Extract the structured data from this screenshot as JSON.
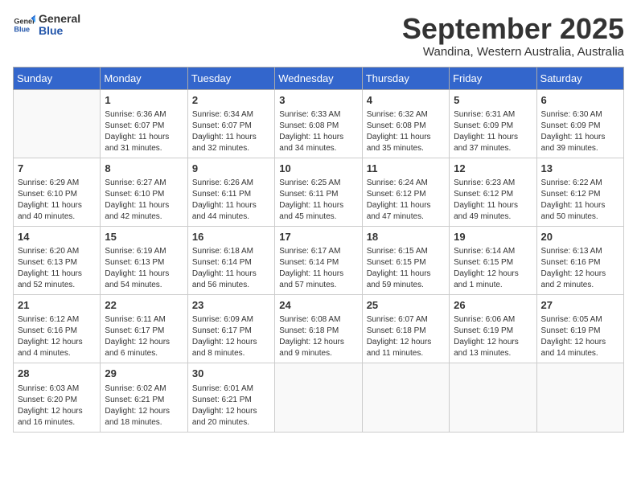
{
  "header": {
    "logo_general": "General",
    "logo_blue": "Blue",
    "month_title": "September 2025",
    "subtitle": "Wandina, Western Australia, Australia"
  },
  "weekdays": [
    "Sunday",
    "Monday",
    "Tuesday",
    "Wednesday",
    "Thursday",
    "Friday",
    "Saturday"
  ],
  "weeks": [
    [
      {
        "day": "",
        "info": ""
      },
      {
        "day": "1",
        "info": "Sunrise: 6:36 AM\nSunset: 6:07 PM\nDaylight: 11 hours\nand 31 minutes."
      },
      {
        "day": "2",
        "info": "Sunrise: 6:34 AM\nSunset: 6:07 PM\nDaylight: 11 hours\nand 32 minutes."
      },
      {
        "day": "3",
        "info": "Sunrise: 6:33 AM\nSunset: 6:08 PM\nDaylight: 11 hours\nand 34 minutes."
      },
      {
        "day": "4",
        "info": "Sunrise: 6:32 AM\nSunset: 6:08 PM\nDaylight: 11 hours\nand 35 minutes."
      },
      {
        "day": "5",
        "info": "Sunrise: 6:31 AM\nSunset: 6:09 PM\nDaylight: 11 hours\nand 37 minutes."
      },
      {
        "day": "6",
        "info": "Sunrise: 6:30 AM\nSunset: 6:09 PM\nDaylight: 11 hours\nand 39 minutes."
      }
    ],
    [
      {
        "day": "7",
        "info": "Sunrise: 6:29 AM\nSunset: 6:10 PM\nDaylight: 11 hours\nand 40 minutes."
      },
      {
        "day": "8",
        "info": "Sunrise: 6:27 AM\nSunset: 6:10 PM\nDaylight: 11 hours\nand 42 minutes."
      },
      {
        "day": "9",
        "info": "Sunrise: 6:26 AM\nSunset: 6:11 PM\nDaylight: 11 hours\nand 44 minutes."
      },
      {
        "day": "10",
        "info": "Sunrise: 6:25 AM\nSunset: 6:11 PM\nDaylight: 11 hours\nand 45 minutes."
      },
      {
        "day": "11",
        "info": "Sunrise: 6:24 AM\nSunset: 6:12 PM\nDaylight: 11 hours\nand 47 minutes."
      },
      {
        "day": "12",
        "info": "Sunrise: 6:23 AM\nSunset: 6:12 PM\nDaylight: 11 hours\nand 49 minutes."
      },
      {
        "day": "13",
        "info": "Sunrise: 6:22 AM\nSunset: 6:12 PM\nDaylight: 11 hours\nand 50 minutes."
      }
    ],
    [
      {
        "day": "14",
        "info": "Sunrise: 6:20 AM\nSunset: 6:13 PM\nDaylight: 11 hours\nand 52 minutes."
      },
      {
        "day": "15",
        "info": "Sunrise: 6:19 AM\nSunset: 6:13 PM\nDaylight: 11 hours\nand 54 minutes."
      },
      {
        "day": "16",
        "info": "Sunrise: 6:18 AM\nSunset: 6:14 PM\nDaylight: 11 hours\nand 56 minutes."
      },
      {
        "day": "17",
        "info": "Sunrise: 6:17 AM\nSunset: 6:14 PM\nDaylight: 11 hours\nand 57 minutes."
      },
      {
        "day": "18",
        "info": "Sunrise: 6:15 AM\nSunset: 6:15 PM\nDaylight: 11 hours\nand 59 minutes."
      },
      {
        "day": "19",
        "info": "Sunrise: 6:14 AM\nSunset: 6:15 PM\nDaylight: 12 hours\nand 1 minute."
      },
      {
        "day": "20",
        "info": "Sunrise: 6:13 AM\nSunset: 6:16 PM\nDaylight: 12 hours\nand 2 minutes."
      }
    ],
    [
      {
        "day": "21",
        "info": "Sunrise: 6:12 AM\nSunset: 6:16 PM\nDaylight: 12 hours\nand 4 minutes."
      },
      {
        "day": "22",
        "info": "Sunrise: 6:11 AM\nSunset: 6:17 PM\nDaylight: 12 hours\nand 6 minutes."
      },
      {
        "day": "23",
        "info": "Sunrise: 6:09 AM\nSunset: 6:17 PM\nDaylight: 12 hours\nand 8 minutes."
      },
      {
        "day": "24",
        "info": "Sunrise: 6:08 AM\nSunset: 6:18 PM\nDaylight: 12 hours\nand 9 minutes."
      },
      {
        "day": "25",
        "info": "Sunrise: 6:07 AM\nSunset: 6:18 PM\nDaylight: 12 hours\nand 11 minutes."
      },
      {
        "day": "26",
        "info": "Sunrise: 6:06 AM\nSunset: 6:19 PM\nDaylight: 12 hours\nand 13 minutes."
      },
      {
        "day": "27",
        "info": "Sunrise: 6:05 AM\nSunset: 6:19 PM\nDaylight: 12 hours\nand 14 minutes."
      }
    ],
    [
      {
        "day": "28",
        "info": "Sunrise: 6:03 AM\nSunset: 6:20 PM\nDaylight: 12 hours\nand 16 minutes."
      },
      {
        "day": "29",
        "info": "Sunrise: 6:02 AM\nSunset: 6:21 PM\nDaylight: 12 hours\nand 18 minutes."
      },
      {
        "day": "30",
        "info": "Sunrise: 6:01 AM\nSunset: 6:21 PM\nDaylight: 12 hours\nand 20 minutes."
      },
      {
        "day": "",
        "info": ""
      },
      {
        "day": "",
        "info": ""
      },
      {
        "day": "",
        "info": ""
      },
      {
        "day": "",
        "info": ""
      }
    ]
  ]
}
